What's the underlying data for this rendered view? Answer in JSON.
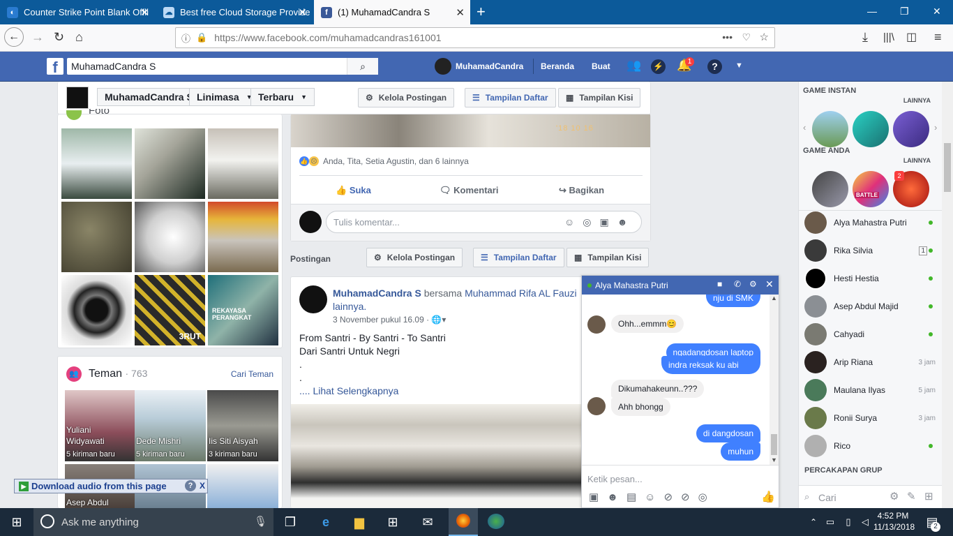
{
  "browser": {
    "tabs": [
      {
        "title": "Counter Strike Point Blank Offli",
        "active": false
      },
      {
        "title": "Best free Cloud Storage Provide",
        "active": false
      },
      {
        "title": "(1) MuhamadCandra S",
        "active": true
      }
    ],
    "url_prefix": "https://www.facebook.com/",
    "url_path": "muhamadcandras161001"
  },
  "fbheader": {
    "logo": "f",
    "search_value": "MuhamadCandra S",
    "profile_name": "MuhamadCandra",
    "home": "Beranda",
    "create": "Buat",
    "notif_count": "1"
  },
  "subnav": {
    "name": "MuhamadCandra S",
    "timeline": "Linimasa",
    "latest": "Terbaru",
    "manage": "Kelola Postingan",
    "list_view": "Tampilan Daftar",
    "grid_view": "Tampilan Kisi"
  },
  "photos": {
    "title": "Foto",
    "overlay_1": "'18 10 16",
    "overlay_3": "3RUT",
    "overlay_4": "REKAYASA PERANGKAT"
  },
  "friends": {
    "title": "Teman",
    "count": "· 763",
    "find": "Cari Teman",
    "items": [
      {
        "name1": "Yuliani",
        "name2": "Widyawati",
        "sub": "5 kiriman baru"
      },
      {
        "name1": "Dede Mishri",
        "name2": "",
        "sub": "5 kiriman baru"
      },
      {
        "name1": "Iis Siti Aisyah",
        "name2": "",
        "sub": "3 kiriman baru"
      },
      {
        "name1": "Asep Abdul",
        "name2": "",
        "sub": ""
      }
    ]
  },
  "post1": {
    "reactions": "Anda, Tita, Setia Agustin, dan 6 lainnya",
    "like": "Suka",
    "comment": "Komentari",
    "share": "Bagikan",
    "comment_placeholder": "Tulis komentar...",
    "photo_date": "'18 10 16"
  },
  "posts_bar": {
    "label": "Postingan",
    "manage": "Kelola Postingan",
    "list_view": "Tampilan Daftar",
    "grid_view": "Tampilan Kisi"
  },
  "post2": {
    "author": "MuhamadCandra S",
    "with": "bersama",
    "tagged": "Muhammad Rifa AL Fauzi",
    "others": "lainnya.",
    "time": "3 November pukul 16.09 ·",
    "line1": "From Santri - By Santri - To Santri",
    "line2": "Dari Santri Untuk Negri",
    "dot1": ".",
    "dot2": ".",
    "more": ".... Lihat Selengkapnya"
  },
  "sidebar": {
    "instant_games": "GAME INSTAN",
    "more1": "LAINNYA",
    "your_games": "GAME ANDA",
    "more2": "LAINNYA",
    "game_badge": "2",
    "game_label": "BATTLE",
    "contacts": [
      {
        "name": "Alya Mahastra Putri",
        "status": "online",
        "time": ""
      },
      {
        "name": "Rika Silvia",
        "status": "online",
        "time": "1"
      },
      {
        "name": "Hesti Hestia",
        "status": "online",
        "time": ""
      },
      {
        "name": "Asep Abdul Majid",
        "status": "online",
        "time": ""
      },
      {
        "name": "Cahyadi",
        "status": "online",
        "time": ""
      },
      {
        "name": "Arip Riana",
        "status": "",
        "time": "3 jam"
      },
      {
        "name": "Maulana Ilyas",
        "status": "",
        "time": "5 jam"
      },
      {
        "name": "Ronii Surya",
        "status": "",
        "time": "3 jam"
      },
      {
        "name": "Rico",
        "status": "online",
        "time": ""
      }
    ],
    "group_chats": "PERCAKAPAN GRUP",
    "search_placeholder": "Cari"
  },
  "chat": {
    "name": "Alya Mahastra Putri",
    "messages": [
      {
        "from": "me",
        "text": "nju di SMK"
      },
      {
        "from": "them",
        "text": "Ohh...emmm😊"
      },
      {
        "from": "me",
        "text": "ngadangdosan laptop"
      },
      {
        "from": "me",
        "text": "indra reksak ku abi"
      },
      {
        "from": "them",
        "text": "Dikumahakeunn..???"
      },
      {
        "from": "them",
        "text": "Ahh bhongg"
      },
      {
        "from": "me",
        "text": "di dangdosan"
      },
      {
        "from": "me",
        "text": "muhun"
      }
    ],
    "input_placeholder": "Ketik pesan..."
  },
  "download_bar": {
    "label": "Download audio from this page",
    "help": "?",
    "close": "X"
  },
  "taskbar": {
    "search": "Ask me anything",
    "time": "4:52 PM",
    "date": "11/13/2018",
    "notif": "2"
  },
  "colors": {
    "fb_blue": "#4267b2",
    "tab_blue": "#0c5a9a",
    "taskbar": "#1b2a3a",
    "online": "#42b72a"
  }
}
